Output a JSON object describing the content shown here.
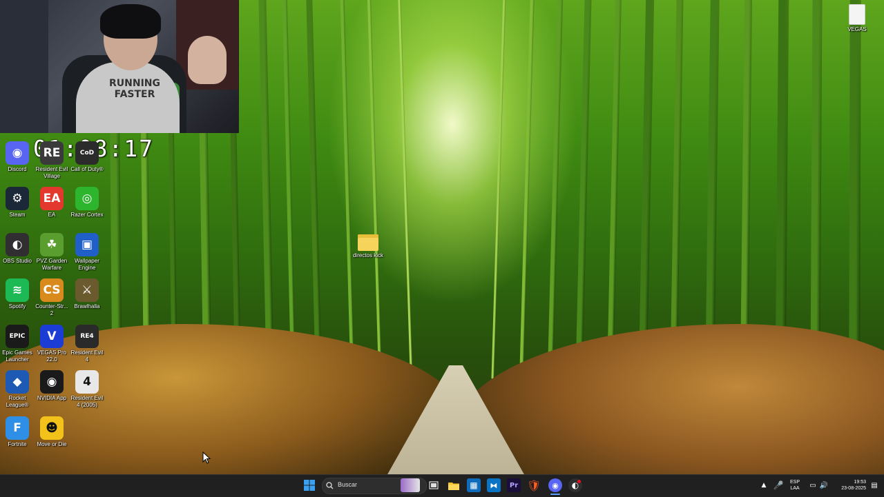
{
  "timer": "01:08:17",
  "webcam": {
    "shirt_text": "RUNNING\nFASTER"
  },
  "desktop_icons": [
    {
      "label": "Discord",
      "icon": "discord-icon",
      "color": "#5865F2",
      "glyph": "◉"
    },
    {
      "label": "Resident Evil Village",
      "icon": "resident-evil-village-icon",
      "color": "#3a3a3a",
      "glyph": "RE"
    },
    {
      "label": "Call of Duty®",
      "icon": "call-of-duty-icon",
      "color": "#2b2b2b",
      "glyph": "CoD"
    },
    {
      "label": "Steam",
      "icon": "steam-icon",
      "color": "#1b2838",
      "glyph": "⚙"
    },
    {
      "label": "EA",
      "icon": "ea-icon",
      "color": "#e2382e",
      "glyph": "EA"
    },
    {
      "label": "Razer Cortex",
      "icon": "razer-cortex-icon",
      "color": "#2db52d",
      "glyph": "◎"
    },
    {
      "label": "OBS Studio",
      "icon": "obs-studio-icon",
      "color": "#302e31",
      "glyph": "◐"
    },
    {
      "label": "PVZ Garden Warfare",
      "icon": "pvz-garden-warfare-icon",
      "color": "#5a9e2f",
      "glyph": "☘"
    },
    {
      "label": "Wallpaper Engine",
      "icon": "wallpaper-engine-icon",
      "color": "#1f5fc7",
      "glyph": "▣"
    },
    {
      "label": "Spotify",
      "icon": "spotify-icon",
      "color": "#1db954",
      "glyph": "≋"
    },
    {
      "label": "Counter-Str... 2",
      "icon": "counter-strike-icon",
      "color": "#d98a1c",
      "glyph": "CS"
    },
    {
      "label": "Brawlhalla",
      "icon": "brawlhalla-icon",
      "color": "#6b5a2e",
      "glyph": "⚔"
    },
    {
      "label": "Epic Games Launcher",
      "icon": "epic-games-icon",
      "color": "#1a1a1a",
      "glyph": "EPIC"
    },
    {
      "label": "VEGAS Pro 22.0",
      "icon": "vegas-pro-icon",
      "color": "#1c3cd6",
      "glyph": "V"
    },
    {
      "label": "Resident Evil 4",
      "icon": "resident-evil-4-icon",
      "color": "#2a2a2a",
      "glyph": "RE4"
    },
    {
      "label": "Rocket League®",
      "icon": "rocket-league-icon",
      "color": "#1e5ab4",
      "glyph": "◆"
    },
    {
      "label": "NVIDIA App",
      "icon": "nvidia-app-icon",
      "color": "#1a1a1a",
      "glyph": "◉"
    },
    {
      "label": "Resident Evil 4 (2005)",
      "icon": "resident-evil-4-2005-icon",
      "color": "#e8e8e8",
      "glyph": "4"
    },
    {
      "label": "Fortnite",
      "icon": "fortnite-icon",
      "color": "#2f8ee6",
      "glyph": "F"
    },
    {
      "label": "Move or Die",
      "icon": "move-or-die-icon",
      "color": "#f2c21b",
      "glyph": "☻"
    }
  ],
  "folder": {
    "label": "directos kick"
  },
  "file": {
    "label": "VEGAS"
  },
  "taskbar": {
    "search_placeholder": "Buscar",
    "lang_top": "ESP",
    "lang_bottom": "LAA",
    "time": "19:53",
    "date": "23-08-2025"
  }
}
